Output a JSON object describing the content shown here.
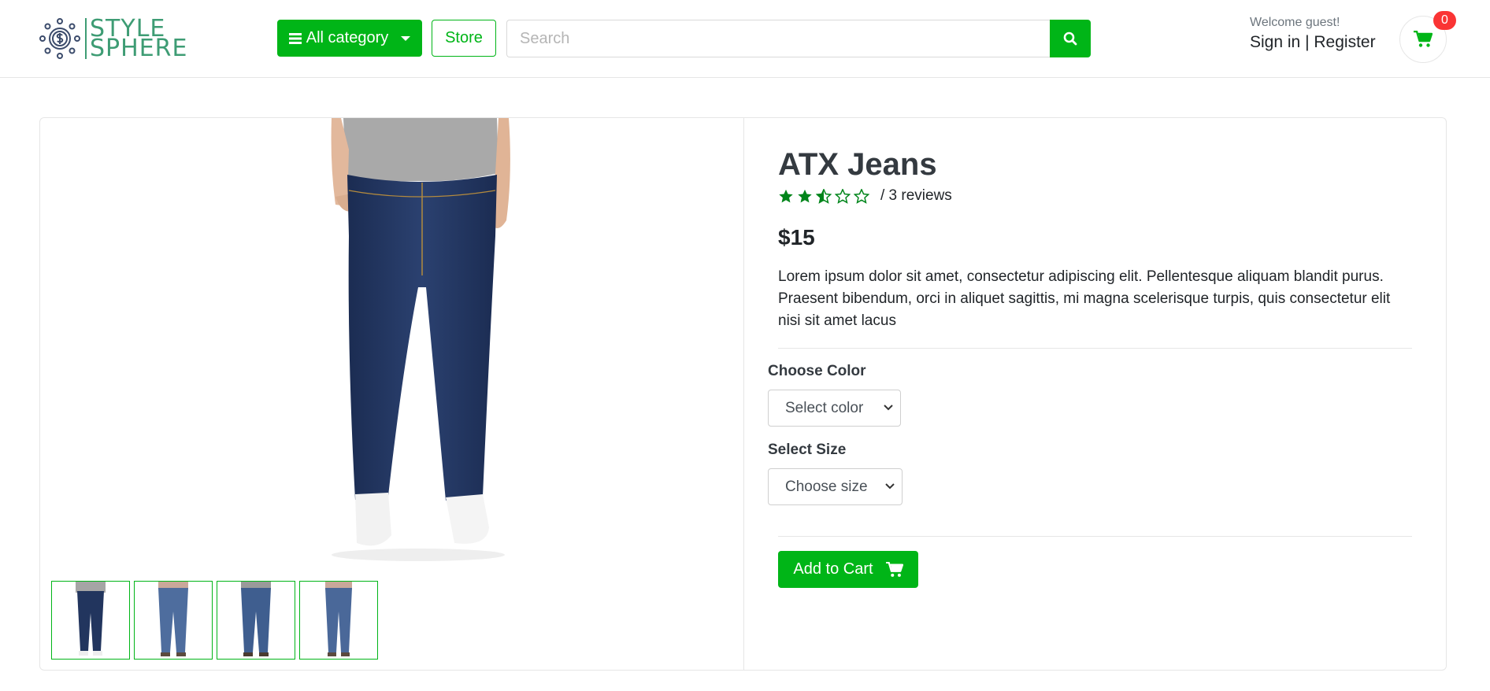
{
  "brand": {
    "line1": "STYLE",
    "line2": "SPHERE",
    "color": "#3e9c74"
  },
  "header": {
    "category_label": "All category",
    "store_label": "Store",
    "search_placeholder": "Search",
    "welcome": "Welcome guest!",
    "sign_in": "Sign in",
    "separator": "|",
    "register": "Register",
    "cart_count": "0"
  },
  "product": {
    "title": "ATX Jeans",
    "rating_stars": 2.5,
    "rating_max": 5,
    "reviews": "/ 3 reviews",
    "price": "$15",
    "description": "Lorem ipsum dolor sit amet, consectetur adipiscing elit. Pellentesque aliquam blandit purus. Praesent bibendum, orci in aliquet sagittis, mi magna scelerisque turpis, quis consectetur elit nisi sit amet lacus",
    "color_label": "Choose Color",
    "color_select": "Select color",
    "size_label": "Select Size",
    "size_select": "Choose size",
    "add_to_cart": "Add to Cart",
    "thumbnail_count": 4
  },
  "colors": {
    "accent": "#00b517",
    "star": "#00851a",
    "badge": "#fa3434",
    "denim_dark": "#22355e",
    "denim_light": "#4e6d9e"
  },
  "icons": {
    "category": "bars-icon",
    "search": "search-icon",
    "cart": "cart-icon",
    "logo": "coin-gear-icon"
  }
}
